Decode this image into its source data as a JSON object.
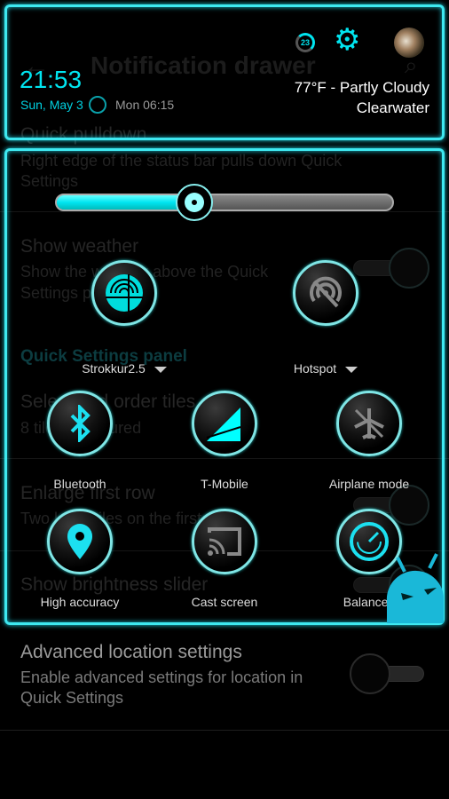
{
  "background_settings": {
    "title": "Notification drawer",
    "items": [
      {
        "title": "Quick pulldown",
        "subtitle_1": "Right edge of the status bar pulls down Quick",
        "subtitle_2": "Settings"
      },
      {
        "title": "Show weather",
        "subtitle_1": "Show the weather above the Quick",
        "subtitle_2": "Settings panel",
        "toggle": false
      },
      {
        "section": "Quick Settings panel"
      },
      {
        "title": "Select and order tiles",
        "subtitle_1": "8 tiles configured"
      },
      {
        "title": "Enlarge first row",
        "subtitle_1": "Two large tiles on the first row",
        "toggle": false
      },
      {
        "title": "Show brightness slider",
        "toggle": false
      },
      {
        "title": "Advanced location settings",
        "subtitle_1": "Enable advanced settings for location in",
        "subtitle_2": "Quick Settings",
        "toggle": false
      }
    ]
  },
  "header": {
    "time": "21:53",
    "date": "Sun, May 3",
    "alarm": "Mon 06:15",
    "weather": "77°F - Partly Cloudy",
    "location": "Clearwater",
    "badge_count": "23",
    "accent": "#00e5f0"
  },
  "brightness": {
    "level_percent": 41
  },
  "tiles": [
    {
      "label": "Strokkur2.5",
      "icon": "wifi-icon",
      "active": true,
      "dropdown": true
    },
    {
      "label": "Hotspot",
      "icon": "hotspot-off-icon",
      "active": false,
      "dropdown": true
    },
    {
      "label": "Bluetooth",
      "icon": "bluetooth-icon",
      "active": true
    },
    {
      "label": "T-Mobile",
      "icon": "cell-signal-icon",
      "active": true
    },
    {
      "label": "Airplane mode",
      "icon": "airplane-off-icon",
      "active": false
    },
    {
      "label": "High accuracy",
      "icon": "location-icon",
      "active": true
    },
    {
      "label": "Cast screen",
      "icon": "cast-icon",
      "active": false
    },
    {
      "label": "Balanced",
      "icon": "performance-gauge-icon",
      "active": true
    }
  ]
}
